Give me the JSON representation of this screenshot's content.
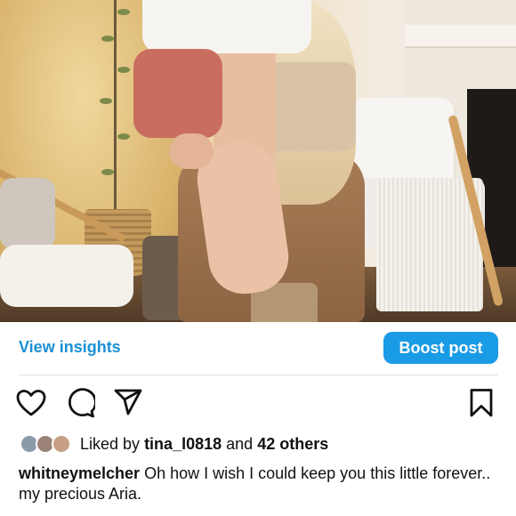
{
  "photo": {
    "description_icon": "post-photo"
  },
  "actions": {
    "view_insights_label": "View insights",
    "boost_label": "Boost post"
  },
  "icons": {
    "like": "heart-icon",
    "comment": "comment-icon",
    "share": "share-icon",
    "save": "save-icon"
  },
  "likes": {
    "prefix": "Liked by",
    "user": "tina_l0818",
    "middle": "and",
    "others": "42 others"
  },
  "caption": {
    "username": "whitneymelcher",
    "text": "Oh how I wish I could keep you this little forever.. my precious Aria."
  },
  "colors": {
    "accent": "#1a9be6",
    "link": "#1a90d4"
  }
}
